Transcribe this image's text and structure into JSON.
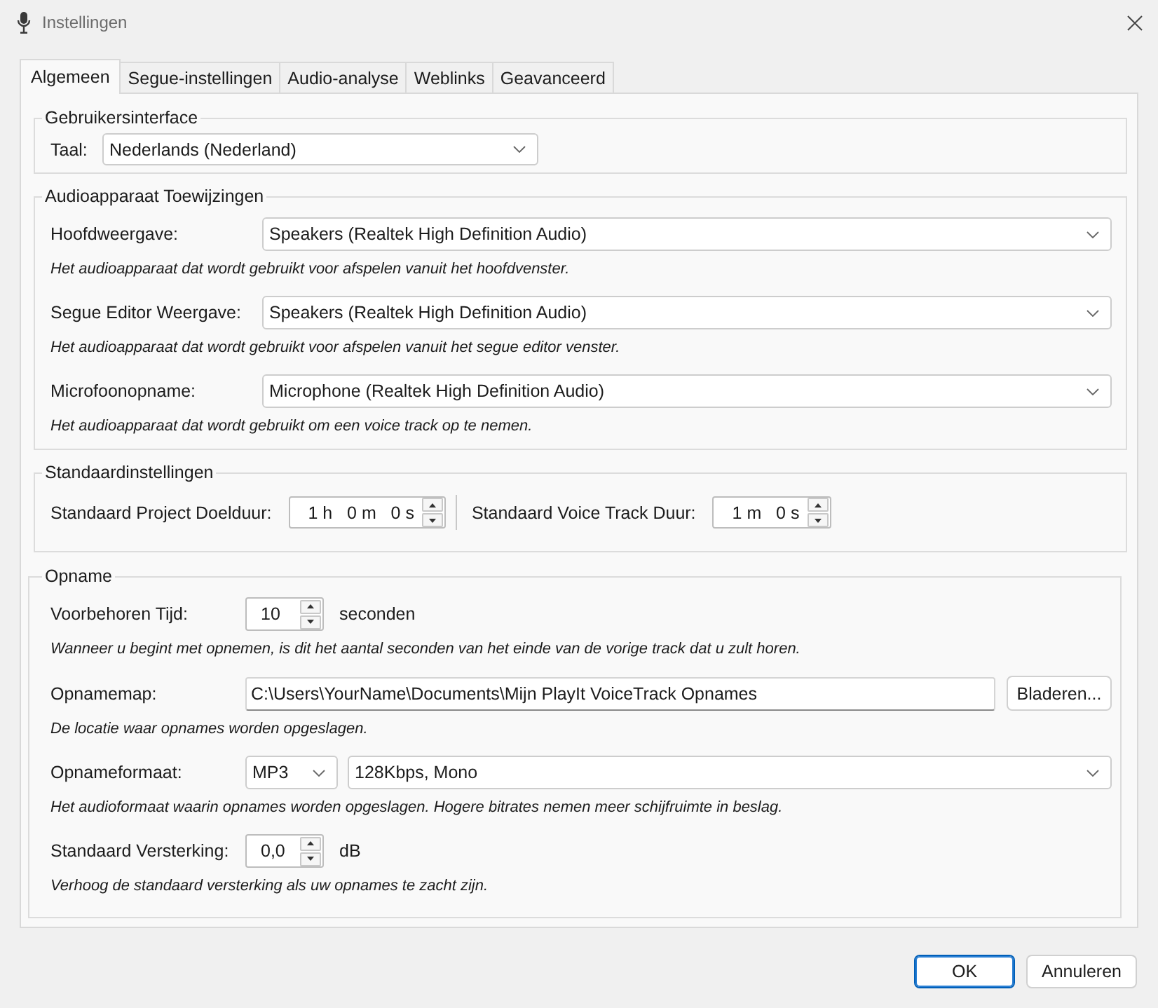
{
  "window": {
    "title": "Instellingen"
  },
  "tabs": [
    {
      "label": "Algemeen",
      "selected": true
    },
    {
      "label": "Segue-instellingen",
      "selected": false
    },
    {
      "label": "Audio-analyse",
      "selected": false
    },
    {
      "label": "Weblinks",
      "selected": false
    },
    {
      "label": "Geavanceerd",
      "selected": false
    }
  ],
  "user_interface": {
    "title": "Gebruikersinterface",
    "language": {
      "label": "Taal:",
      "value": "Nederlands (Nederland)"
    }
  },
  "audio_devices": {
    "title": "Audioapparaat Toewijzingen",
    "rows": [
      {
        "label": "Hoofdweergave:",
        "value": "Speakers (Realtek High Definition Audio)",
        "hint": "Het audioapparaat dat wordt gebruikt voor afspelen vanuit het hoofdvenster."
      },
      {
        "label": "Segue Editor Weergave:",
        "value": "Speakers (Realtek High Definition Audio)",
        "hint": "Het audioapparaat dat wordt gebruikt voor afspelen vanuit het segue editor venster."
      },
      {
        "label": "Microfoonopname:",
        "value": "Microphone (Realtek High Definition Audio)",
        "hint": "Het audioapparaat dat wordt gebruikt om een voice track op te nemen."
      }
    ]
  },
  "defaults": {
    "title": "Standaardinstellingen",
    "durations": [
      {
        "label": "Standaard Project Doelduur:",
        "value": "1 h   0 m   0 s"
      },
      {
        "label": "Standaard Voice Track Duur:",
        "value": "1 m   0 s"
      }
    ]
  },
  "recording": {
    "title": "Opname",
    "rows": [
      {
        "kind": "spinner",
        "label": "Voorbehoren Tijd:",
        "value": "10",
        "unit": "seconden",
        "hint": "Wanneer u begint met opnemen, is dit het aantal seconden van het einde van de vorige track dat u zult horen."
      },
      {
        "kind": "folder",
        "label": "Opnamemap:",
        "value": "C:\\Users\\YourName\\Documents\\Mijn PlayIt VoiceTrack Opnames",
        "button": "Bladeren...",
        "hint": "De locatie waar opnames worden opgeslagen."
      },
      {
        "kind": "format",
        "label": "Opnameformaat:",
        "format": "MP3",
        "quality": "128Kbps, Mono",
        "hint": "Het audioformaat waarin opnames worden opgeslagen. Hogere bitrates nemen meer schijfruimte in beslag."
      },
      {
        "kind": "spinner",
        "label": "Standaard Versterking:",
        "value": "0,0",
        "unit": "dB",
        "hint": "Verhoog de standaard versterking als uw opnames te zacht zijn."
      }
    ]
  },
  "buttons": [
    {
      "label": "OK",
      "default": true
    },
    {
      "label": "Annuleren",
      "default": false
    }
  ]
}
